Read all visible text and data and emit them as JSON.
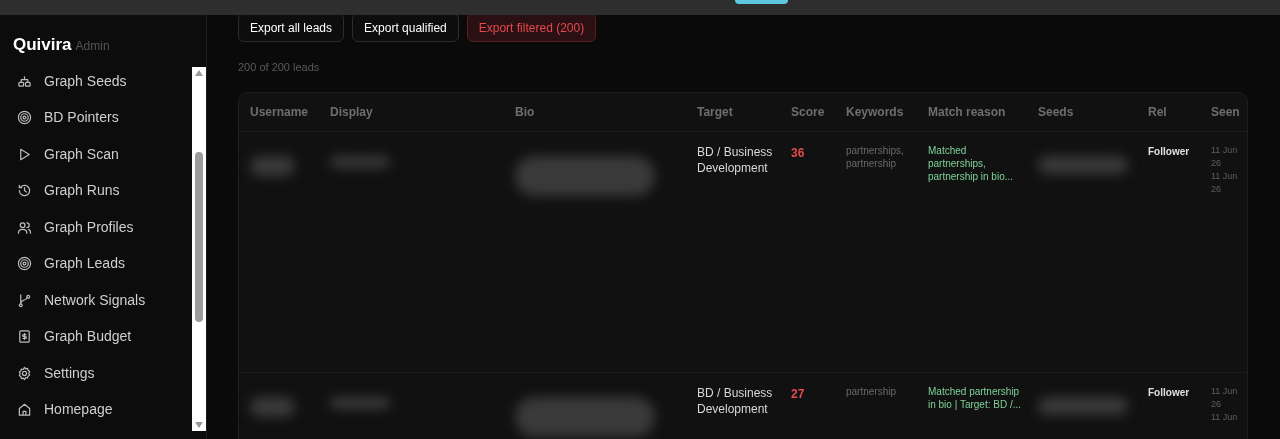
{
  "brand": {
    "name": "Quivira",
    "role": "Admin"
  },
  "sidebar": {
    "items": [
      {
        "label": "Graph Seeds",
        "kind": "seeds"
      },
      {
        "label": "BD Pointers",
        "kind": "target"
      },
      {
        "label": "Graph Scan",
        "kind": "play"
      },
      {
        "label": "Graph Runs",
        "kind": "history"
      },
      {
        "label": "Graph Profiles",
        "kind": "users"
      },
      {
        "label": "Graph Leads",
        "kind": "target"
      },
      {
        "label": "Network Signals",
        "kind": "branch"
      },
      {
        "label": "Graph Budget",
        "kind": "budget"
      },
      {
        "label": "Settings",
        "kind": "gear"
      },
      {
        "label": "Homepage",
        "kind": "home"
      }
    ]
  },
  "toolbar": {
    "buttons": [
      {
        "label": "Export all leads",
        "kind": "default"
      },
      {
        "label": "Export qualified",
        "kind": "default"
      },
      {
        "label": "Export filtered (200)",
        "kind": "danger"
      }
    ]
  },
  "count": "200 of 200 leads",
  "table": {
    "columns": [
      "Username",
      "Display",
      "Bio",
      "Target",
      "Score",
      "Keywords",
      "Match reason",
      "Seeds",
      "Rel",
      "Seen"
    ],
    "rows": [
      {
        "target": "BD / Business Development",
        "score": "36",
        "keywords": "partnerships, partnership",
        "match_reason": "Matched partnerships, partnership in bio...",
        "rel": "Follower",
        "seen": [
          "11 Jun 26",
          "11 Jun 26"
        ]
      },
      {
        "target": "BD / Business Development",
        "score": "27",
        "keywords": "partnership",
        "match_reason": "Matched partnership in bio | Target: BD /...",
        "rel": "Follower",
        "seen": [
          "11 Jun 26",
          "11 Jun"
        ]
      }
    ]
  }
}
